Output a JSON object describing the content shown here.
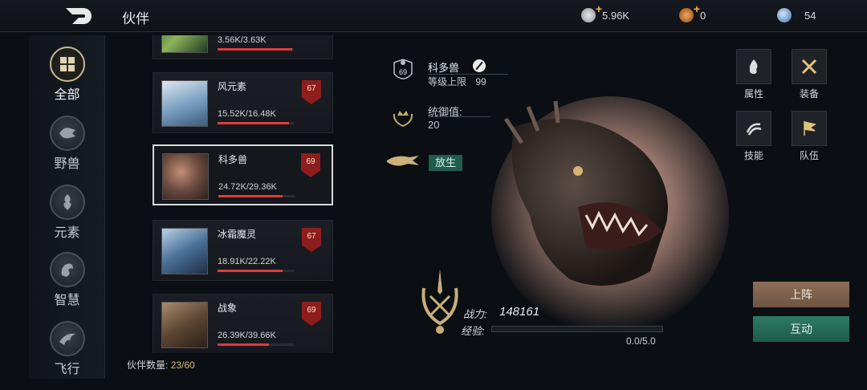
{
  "header": {
    "title": "伙伴"
  },
  "resources": [
    {
      "icon": "silver-coin-icon",
      "value": "5.96K",
      "has_plus": true
    },
    {
      "icon": "bronze-medal-icon",
      "value": "0",
      "has_plus": true
    },
    {
      "icon": "crystal-orb-icon",
      "value": "54",
      "has_plus": false
    }
  ],
  "sidebar": {
    "items": [
      {
        "label": "全部",
        "icon": "grid-icon",
        "active": true
      },
      {
        "label": "野兽",
        "icon": "beast-icon",
        "active": false
      },
      {
        "label": "元素",
        "icon": "element-icon",
        "active": false
      },
      {
        "label": "智慧",
        "icon": "wisdom-icon",
        "active": false
      },
      {
        "label": "飞行",
        "icon": "flying-icon",
        "active": false
      }
    ]
  },
  "companions": [
    {
      "name": "",
      "stat": "3.56K/3.63K",
      "level": "",
      "fill": 0.98
    },
    {
      "name": "风元素",
      "stat": "15.52K/16.48K",
      "level": "67",
      "fill": 0.94
    },
    {
      "name": "科多兽",
      "stat": "24.72K/29.36K",
      "level": "69",
      "fill": 0.84,
      "selected": true
    },
    {
      "name": "冰霜魔灵",
      "stat": "18.91K/22.22K",
      "level": "67",
      "fill": 0.85
    },
    {
      "name": "战象",
      "stat": "26.39K/39.66K",
      "level": "69",
      "fill": 0.67
    }
  ],
  "count": {
    "label": "伙伴数量:",
    "value": "23/60"
  },
  "detail": {
    "level_badge": "69",
    "name": "科多兽",
    "level_cap_label": "等级上限",
    "level_cap_value": "99",
    "command_label": "统御值:",
    "command_value": "20",
    "release_label": "放生"
  },
  "right_menu": {
    "attributes": "属性",
    "equipment": "装备",
    "skills": "技能",
    "team": "队伍"
  },
  "stats": {
    "power_label": "战力:",
    "power_value": "148161",
    "exp_label": "经验:",
    "exp_value": "0.0/5.0",
    "exp_fill": 0
  },
  "actions": {
    "deploy": "上阵",
    "interact": "互动"
  },
  "colors": {
    "hp_bar": "#e03b3b",
    "level_badge": "#8e1d1d",
    "release": "#1f5e4c",
    "deploy": "#8d6d57",
    "interact": "#2d7a62"
  }
}
